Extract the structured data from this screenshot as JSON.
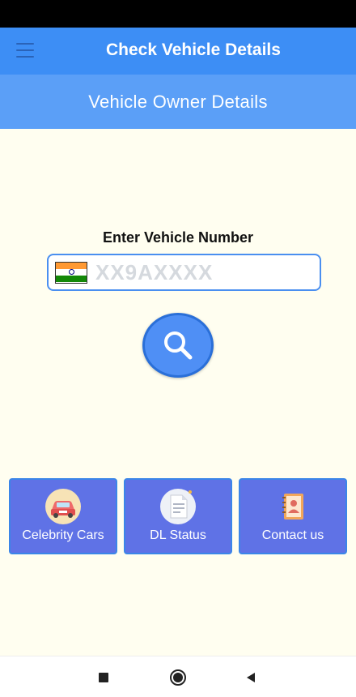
{
  "app_bar": {
    "title": "Check Vehicle Details",
    "menu_icon": "hamburger-menu-icon"
  },
  "sub_header": {
    "title": "Vehicle Owner Details"
  },
  "search": {
    "label": "Enter Vehicle Number",
    "placeholder": "XX9AXXXX",
    "value": "",
    "flag_icon": "india-flag-icon",
    "button_icon": "magnifier-icon"
  },
  "cards": [
    {
      "label": "Celebrity Cars",
      "icon": "car-icon"
    },
    {
      "label": "DL Status",
      "icon": "document-icon"
    },
    {
      "label": "Contact us",
      "icon": "contact-book-icon"
    }
  ],
  "nav": {
    "recents_icon": "square-icon",
    "home_icon": "circle-home-icon",
    "back_icon": "triangle-back-icon"
  },
  "colors": {
    "app_bar": "#3d8ef5",
    "sub_header": "#5b9ff7",
    "background": "#fffef0",
    "card": "#5f72e6",
    "accent": "#4f8ff5"
  }
}
